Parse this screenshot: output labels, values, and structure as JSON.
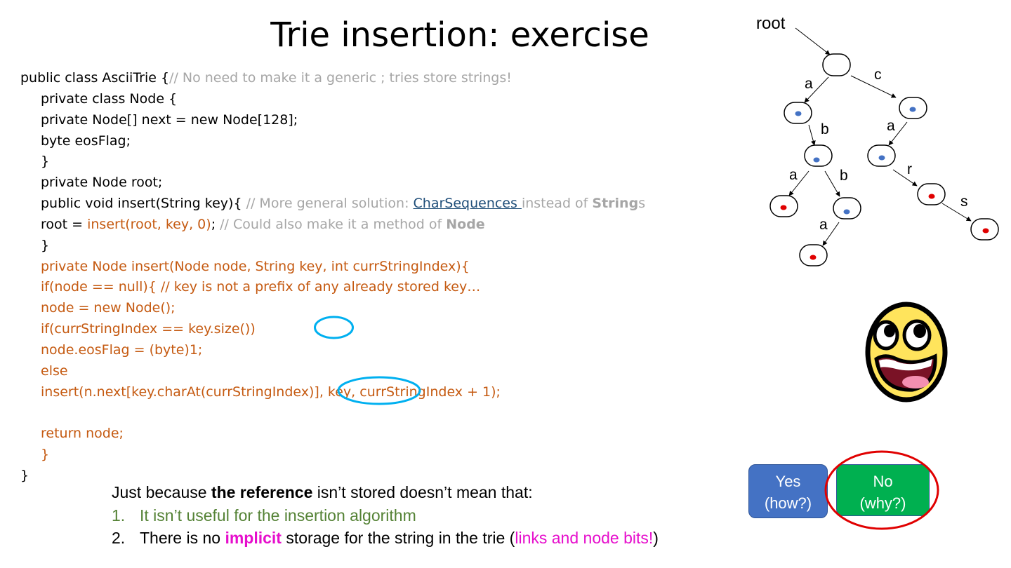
{
  "slide": {
    "title": "Trie insertion: exercise"
  },
  "code": {
    "l1_a": "public class AsciiTrie {",
    "l1_b": "// No need to make it a generic ; tries store strings!",
    "l2": "private class Node {",
    "l3": "private Node[] next = new Node[128];",
    "l4": "byte eosFlag;",
    "l5": "}",
    "l6": "private Node root;",
    "l7_a": "public void insert(String key){ ",
    "l7_b": "// More general solution: ",
    "l7_link": "CharSequences ",
    "l7_c": "instead of ",
    "l7_d": "String",
    "l7_e": "s",
    "l8_a": "root = ",
    "l8_b": "insert(root, key, 0)",
    "l8_c": "; ",
    "l8_d": "// Could also make it a method of ",
    "l8_e": "Node",
    "l9": "}",
    "l10": "private Node insert(Node node, String key, int currStringIndex){",
    "l11": "if(node == null){ // key is not a prefix of any already stored key…",
    "l12": "node = new Node();",
    "l13": "if(currStringIndex == key.size())",
    "l14": "node.eosFlag = (byte)1;",
    "l15": "else",
    "l16": "insert(n.next[key.charAt(currStringIndex)], key, currStringIndex + 1);",
    "l17": "",
    "l18": "return node;",
    "l19": "}",
    "l20": "}"
  },
  "bottom": {
    "intro_a": "Just because ",
    "intro_b": "the reference",
    "intro_c": " isn’t stored doesn’t mean that:",
    "item1_num": "1.",
    "item1_text": "It isn’t useful for the insertion algorithm",
    "item2_num": "2.",
    "item2_a": "There is no ",
    "item2_b": "implicit",
    "item2_c": " storage for the string in the trie (",
    "item2_d": "links and node bits!",
    "item2_e": ")"
  },
  "trie": {
    "root_label": "root",
    "edge_labels": [
      "a",
      "c",
      "b",
      "a",
      "a",
      "b",
      "r",
      "s",
      "a"
    ]
  },
  "buttons": {
    "yes_line1": "Yes",
    "yes_line2": "(how?)",
    "no_line1": "No",
    "no_line2": "(why?)"
  },
  "colors": {
    "code_comment": "#a6a6a6",
    "code_highlight": "#c55a11",
    "link": "#1f4e79",
    "green_text": "#548235",
    "magenta_text": "#e60ecc",
    "annotation_circle": "#00b0f0",
    "answer_circle": "#e00000",
    "yes_button": "#4472c4",
    "no_button": "#00b050",
    "node_dot_blue": "#4472c4",
    "node_dot_red": "#e00000"
  },
  "icons": [
    "smiley-face-icon"
  ]
}
